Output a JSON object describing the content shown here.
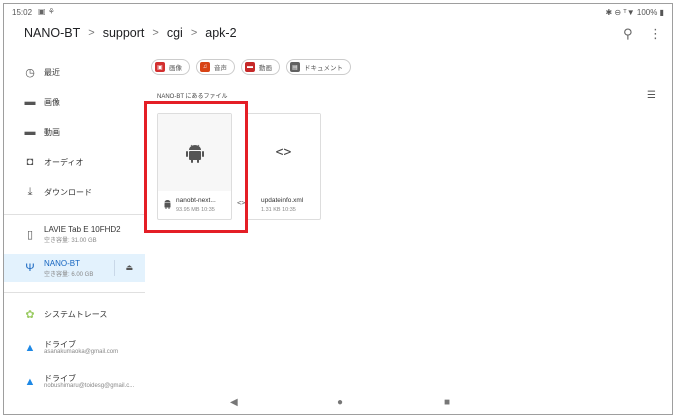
{
  "status_bar": {
    "time": "15:02",
    "left_icons": "▣ ⚘",
    "right_text": "✱ ⊖ ᵀ▼ 100% ▮"
  },
  "header": {
    "breadcrumbs": [
      "NANO-BT",
      "support",
      "cgi",
      "apk-2"
    ],
    "separator": ">",
    "search_icon": "⚲",
    "more_icon": "⋮"
  },
  "sidebar": {
    "items": [
      {
        "label": "最近",
        "icon": "◷"
      },
      {
        "label": "画像",
        "icon": "▬"
      },
      {
        "label": "動画",
        "icon": "▬"
      },
      {
        "label": "オーディオ",
        "icon": "◘"
      },
      {
        "label": "ダウンロード",
        "icon": "⤓"
      }
    ],
    "devices": [
      {
        "label": "LAVIE Tab E 10FHD2",
        "sub": "空き容量: 31.00 GB",
        "icon": "▯"
      },
      {
        "label": "NANO-BT",
        "sub": "空き容量: 6.00 GB",
        "icon": "Ψ",
        "eject": "⏏"
      }
    ],
    "apps": [
      {
        "label": "システムトレース",
        "icon": "✿"
      },
      {
        "label": "ドライブ",
        "sub": "asanakumaoka@gmail.com",
        "icon": "▲"
      },
      {
        "label": "ドライブ",
        "sub": "nobushimaru@toidesg@gmail.c...",
        "icon": "▲"
      }
    ]
  },
  "main": {
    "chips": [
      {
        "label": "画像",
        "color": "#d32f2f",
        "icon": "▣"
      },
      {
        "label": "音声",
        "color": "#d84315",
        "icon": "♫"
      },
      {
        "label": "動画",
        "color": "#c62828",
        "icon": "▬"
      },
      {
        "label": "ドキュメント",
        "color": "#616161",
        "icon": "▤"
      }
    ],
    "section_title": "NANO-BT にあるファイル",
    "view_toggle_icon": "☰",
    "files": [
      {
        "name": "nanobt-next...",
        "info": "93.95 MB 10:35",
        "thumb_icon": "android",
        "small_icon": "android"
      },
      {
        "name": "updateinfo.xml",
        "info": "1.31 KB 10:35",
        "thumb_icon": "<>",
        "small_icon": "<>"
      }
    ]
  },
  "navbar": {
    "back": "◀",
    "home": "●",
    "recents": "■"
  },
  "colors": {
    "highlight": "#e41e26",
    "active_bg": "#e3f2fd",
    "active_text": "#1565c0"
  }
}
